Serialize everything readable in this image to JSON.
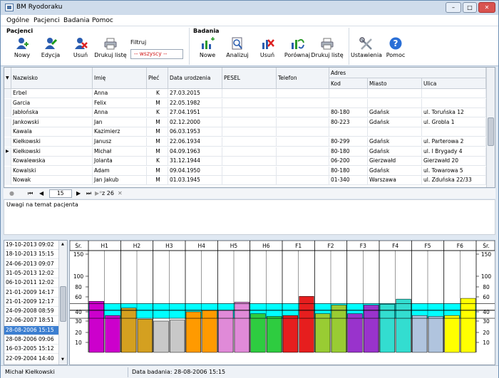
{
  "window": {
    "title": "BM Ryodoraku",
    "btn_min": "–",
    "btn_max": "□",
    "btn_close": "✕"
  },
  "menu": [
    "Ogólne",
    "Pacjenci",
    "Badania",
    "Pomoc"
  ],
  "toolbar": {
    "patients_group": "Pacjenci",
    "exams_group": "Badania",
    "new_patient": "Nowy",
    "edit_patient": "Edycja",
    "delete_patient": "Usuń",
    "print_list": "Drukuj listę",
    "filter_label": "Filtruj",
    "filter_value": "-- wszyscy --",
    "new_exam": "Nowe",
    "analyze": "Analizuj",
    "delete_exam": "Usuń",
    "compare": "Porównaj",
    "print_exam_list": "Drukuj listę",
    "settings": "Ustawienia",
    "help": "Pomoc"
  },
  "grid": {
    "headers": {
      "surname": "Nazwisko",
      "name": "Imię",
      "sex": "Płeć",
      "dob": "Data urodzenia",
      "pesel": "PESEL",
      "phone": "Telefon",
      "address": "Adres",
      "postal": "Kod",
      "city": "Miasto",
      "street": "Ulica"
    },
    "rows": [
      {
        "surname": "Erbel",
        "name": "Anna",
        "sex": "K",
        "dob": "27.03.2015",
        "postal": "",
        "city": "",
        "street": ""
      },
      {
        "surname": "Garcia",
        "name": "Felix",
        "sex": "M",
        "dob": "22.05.1982",
        "postal": "",
        "city": "",
        "street": ""
      },
      {
        "surname": "Jabłońska",
        "name": "Anna",
        "sex": "K",
        "dob": "27.04.1951",
        "postal": "80-180",
        "city": "Gdańsk",
        "street": "ul. Toruńska 12"
      },
      {
        "surname": "Jankowski",
        "name": "Jan",
        "sex": "M",
        "dob": "02.12.2000",
        "postal": "80-223",
        "city": "Gdańsk",
        "street": "ul. Grobla 1"
      },
      {
        "surname": "Kawala",
        "name": "Kazimierz",
        "sex": "M",
        "dob": "06.03.1953",
        "postal": "",
        "city": "",
        "street": ""
      },
      {
        "surname": "Kiełkowski",
        "name": "Janusz",
        "sex": "M",
        "dob": "22.06.1934",
        "postal": "80-299",
        "city": "Gdańsk",
        "street": "ul. Parterowa 2"
      },
      {
        "surname": "Kiełkowski",
        "name": "Michał",
        "sex": "M",
        "dob": "04.09.1963",
        "postal": "80-180",
        "city": "Gdańsk",
        "street": "ul. I Brygady 4"
      },
      {
        "surname": "Kowalewska",
        "name": "Jolanta",
        "sex": "K",
        "dob": "31.12.1944",
        "postal": "06-200",
        "city": "Gierzwałd",
        "street": "Gierzwałd 20"
      },
      {
        "surname": "Kowalski",
        "name": "Adam",
        "sex": "M",
        "dob": "09.04.1950",
        "postal": "80-180",
        "city": "Gdańsk",
        "street": "ul. Towarowa 5"
      },
      {
        "surname": "Nowak",
        "name": "Jan Jakub",
        "sex": "M",
        "dob": "01.03.1945",
        "postal": "01-340",
        "city": "Warszawa",
        "street": "ul. Zduńska 22/33"
      }
    ]
  },
  "navigator": {
    "page": "15",
    "of_text": "z 26"
  },
  "notes": {
    "label": "Uwagi na temat pacjenta"
  },
  "exam_dates": [
    "19-10-2013 09:02",
    "18-10-2013 15:15",
    "24-06-2013 09:07",
    "31-05-2013 12:02",
    "06-10-2011 12:02",
    "21-01-2009 14:17",
    "21-01-2009 12:17",
    "24-09-2008 08:59",
    "22-06-2007 18:51",
    "28-08-2006 15:15",
    "28-08-2006 09:06",
    "16-03-2005 15:12",
    "22-09-2004 14:40"
  ],
  "chart_data": {
    "type": "bar",
    "categories": [
      "H1",
      "H2",
      "H3",
      "H4",
      "H5",
      "H6",
      "F1",
      "F2",
      "F3",
      "F4",
      "F5",
      "F6"
    ],
    "series": [
      {
        "values": [
          54,
          45,
          30,
          40,
          42,
          38,
          36,
          38,
          38,
          50,
          36,
          36
        ]
      },
      {
        "values": [
          36,
          32,
          31,
          42,
          53,
          35,
          61,
          49,
          49,
          57,
          35,
          58
        ]
      }
    ],
    "colors": [
      "#cc00cc",
      "#d4a020",
      "#c8c8c8",
      "#ff9a00",
      "#e08ad8",
      "#2ecc40",
      "#e61e1e",
      "#99cc33",
      "#9933cc",
      "#33ddd0",
      "#b0c4de",
      "#ffff00"
    ],
    "mean_label": "Śr.",
    "yticks": [
      150,
      100,
      80,
      60,
      40,
      30,
      20,
      10
    ],
    "ylim": [
      0,
      160
    ],
    "scale": "nonlinear",
    "band": [
      33,
      51
    ],
    "mean_line": 42,
    "band_color": "#00ffff"
  },
  "status": {
    "patient": "Michał Kiełkowski",
    "exam_date": "Data badania: 28-08-2006 15:15"
  }
}
